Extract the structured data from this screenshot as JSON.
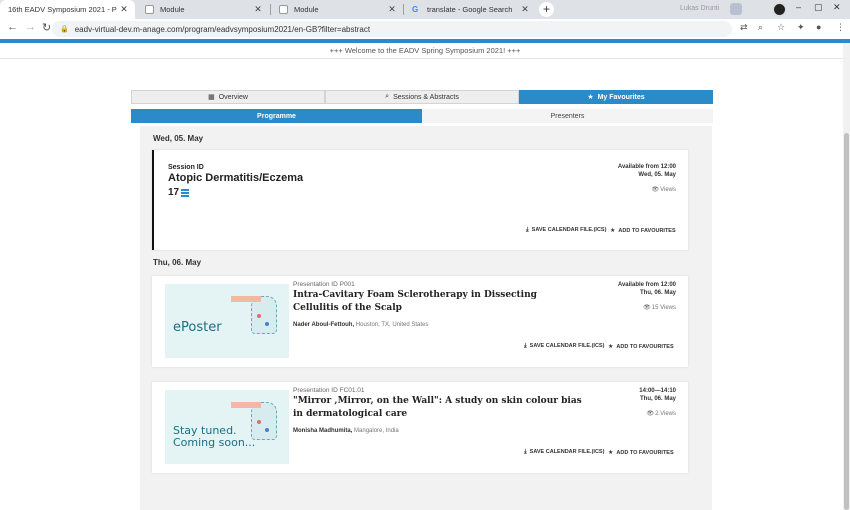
{
  "browser": {
    "tabs": [
      {
        "title": "16th EADV Symposium 2021 - P",
        "active": true
      },
      {
        "title": "Module",
        "active": false
      },
      {
        "title": "Module",
        "active": false
      },
      {
        "title": "translate - Google Search",
        "active": false
      }
    ],
    "new_tab": "+",
    "url": "eadv-virtual-dev.m-anage.com/program/eadvsymposium2021/en-GB?filter=abstract",
    "profile_name": "Lukas Drunti"
  },
  "colors": {
    "accent": "#2a8bc8",
    "content_bg": "#f2f2f2"
  },
  "welcome_text": "+++ Welcome to the EADV Spring Symposium 2021! +++",
  "main_tabs": [
    {
      "label": "Overview",
      "icon": "calendar-icon",
      "active": false
    },
    {
      "label": "Sessions & Abstracts",
      "icon": "search-icon",
      "active": false
    },
    {
      "label": "My Favourites",
      "icon": "star-icon",
      "active": true
    }
  ],
  "sub_tabs": [
    {
      "label": "Programme",
      "active": true
    },
    {
      "label": "Presenters",
      "active": false
    }
  ],
  "days": [
    {
      "date": "Wed, 05. May",
      "session": {
        "id_label": "Session ID",
        "title": "Atopic Dermatitis/Eczema",
        "count": "17",
        "available": "Available from 12:00",
        "date": "Wed, 05. May",
        "views": "Views",
        "actions": {
          "calendar": "SAVE CALENDAR FILE.(ICS)",
          "favourite": "ADD TO FAVOURITES"
        }
      }
    },
    {
      "date": "Thu, 06. May",
      "presentations": [
        {
          "pid": "Presentation ID P001",
          "title": "Intra-Cavitary Foam Sclerotherapy in Dissecting Cellulitis of the Scalp",
          "author": "Nader Aboul-Fettouh,",
          "location": "Houston, TX, United States",
          "time": "Available from 12:00",
          "date": "Thu, 06. May",
          "views": "15 Views",
          "thumb_text": [
            "ePoster"
          ],
          "actions": {
            "calendar": "SAVE CALENDAR FILE.(ICS)",
            "favourite": "ADD TO FAVOURITES"
          }
        },
        {
          "pid": "Presentation ID FC01.01",
          "title": "\"Mirror ,Mirror, on the Wall\": A study on skin colour bias in dermatological care",
          "author": "Monisha Madhumita,",
          "location": "Mangalore, India",
          "time": "14:00—14:10",
          "date": "Thu, 06. May",
          "views": "2 Views",
          "thumb_text": [
            "Stay tuned.",
            "Coming soon..."
          ],
          "actions": {
            "calendar": "SAVE CALENDAR FILE.(ICS)",
            "favourite": "ADD TO FAVOURITES"
          }
        }
      ]
    }
  ]
}
